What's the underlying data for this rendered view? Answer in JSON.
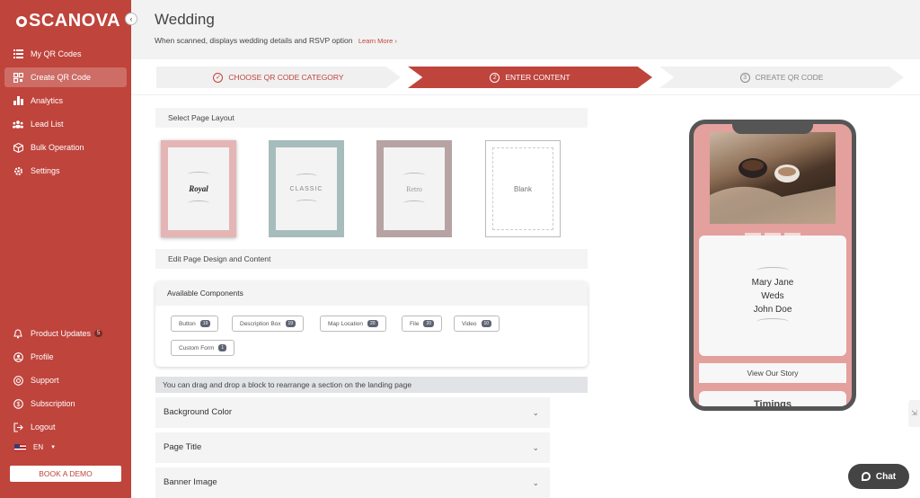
{
  "brand": {
    "name": "SCANOVA",
    "accent": "#bf443c"
  },
  "sidebar": {
    "collapse_icon": "chevron-left",
    "items": [
      {
        "label": "My QR Codes",
        "icon": "list-icon",
        "active": false
      },
      {
        "label": "Create QR Code",
        "icon": "qr-icon",
        "active": true
      },
      {
        "label": "Analytics",
        "icon": "bar-chart-icon",
        "active": false
      },
      {
        "label": "Lead List",
        "icon": "users-icon",
        "active": false
      },
      {
        "label": "Bulk Operation",
        "icon": "box-icon",
        "active": false
      },
      {
        "label": "Settings",
        "icon": "gear-icon",
        "active": false
      }
    ],
    "bottom_items": [
      {
        "label": "Product Updates",
        "icon": "bell-icon",
        "badge": "5"
      },
      {
        "label": "Profile",
        "icon": "user-icon"
      },
      {
        "label": "Support",
        "icon": "support-icon"
      },
      {
        "label": "Subscription",
        "icon": "dollar-icon"
      },
      {
        "label": "Logout",
        "icon": "logout-icon"
      }
    ],
    "language": "EN",
    "demo_button": "BOOK A DEMO"
  },
  "header": {
    "title": "Wedding",
    "subtitle": "When scanned, displays wedding details and RSVP option",
    "learn_more": "Learn More ›"
  },
  "steps": [
    {
      "num": "✓",
      "label": "CHOOSE QR CODE CATEGORY"
    },
    {
      "num": "2",
      "label": "ENTER CONTENT"
    },
    {
      "num": "3",
      "label": "CREATE QR CODE"
    }
  ],
  "layout_section": {
    "title": "Select Page Layout",
    "layouts": [
      {
        "label": "Royal",
        "color": "#e5b5b5"
      },
      {
        "label": "CLASSIC",
        "color": "#a7bcbc"
      },
      {
        "label": "Retro",
        "color": "#b7a3a3"
      },
      {
        "label": "Blank",
        "color": "#ffffff"
      }
    ]
  },
  "design_section": {
    "title": "Edit Page Design and Content"
  },
  "components": {
    "title": "Available Components",
    "chips": [
      {
        "label": "Button",
        "count": "19"
      },
      {
        "label": "Description Box",
        "count": "19"
      },
      {
        "label": "Map Location",
        "count": "20"
      },
      {
        "label": "File",
        "count": "20"
      },
      {
        "label": "Video",
        "count": "10"
      },
      {
        "label": "Custom Form",
        "count": "1"
      }
    ]
  },
  "drag_hint": "You can drag and drop a block to rearrange a section on the landing page",
  "accordions": [
    "Background Color",
    "Page Title",
    "Banner Image"
  ],
  "preview": {
    "names": [
      "Mary Jane",
      "Weds",
      "John Doe"
    ],
    "story_button": "View Our Story",
    "timings": "Timings"
  },
  "chat": {
    "label": "Chat"
  }
}
